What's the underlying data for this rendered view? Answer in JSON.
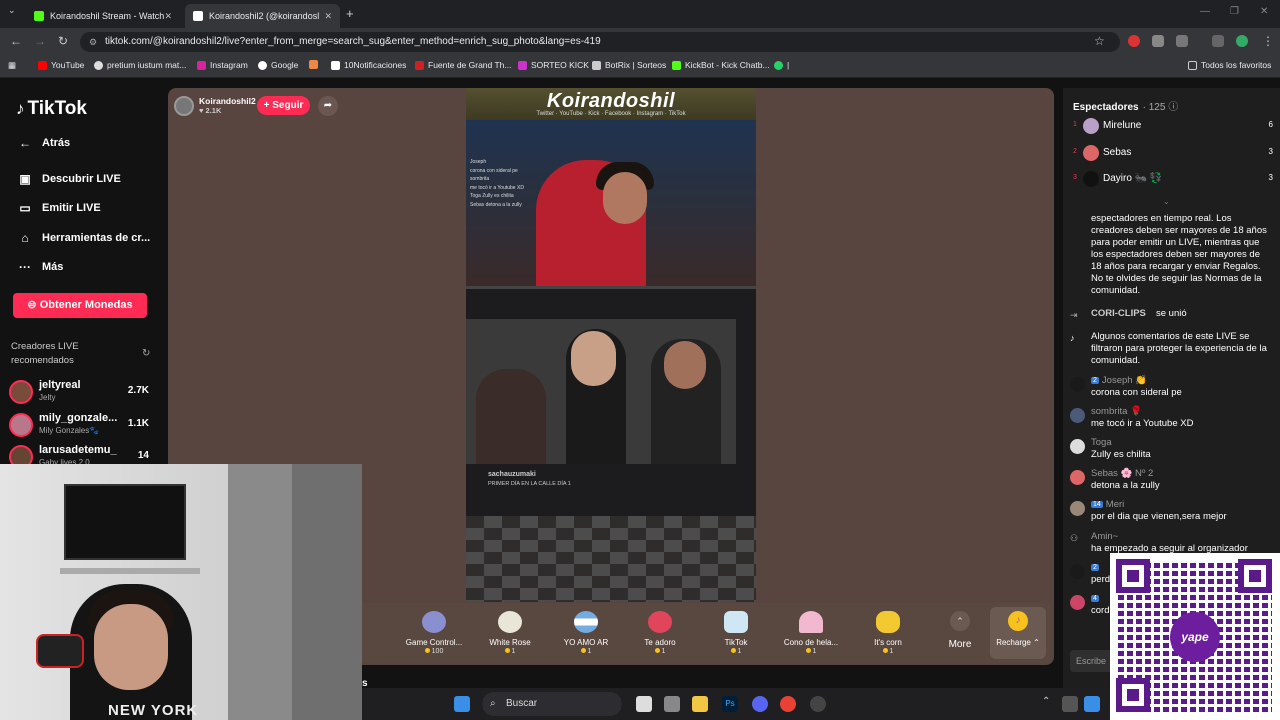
{
  "browser": {
    "tabs": [
      {
        "title": "Koirandoshil Stream - Watch Li"
      },
      {
        "title": "Koirandoshil2 (@koirandosl"
      }
    ],
    "url": "tiktok.com/@koirandoshil2/live?enter_from_merge=search_sug&enter_method=enrich_sug_photo&lang=es-419",
    "bookmarks": [
      "YouTube",
      "pretium iustum mat...",
      "Instagram",
      "Google",
      "10Notificaciones",
      "Fuente de Grand Th...",
      "SORTEO KICK",
      "BotRix | Sorteos",
      "KickBot - Kick Chatb...",
      "|"
    ],
    "all_favorites": "Todos los favoritos"
  },
  "sidebar": {
    "logo": "TikTok",
    "nav": [
      {
        "label": "Atrás"
      },
      {
        "label": "Descubrir LIVE"
      },
      {
        "label": "Emitir LIVE"
      },
      {
        "label": "Herramientas de cr..."
      },
      {
        "label": "Más"
      }
    ],
    "coins_button": "Obtener Monedas",
    "recommended_title": "Creadores LIVE recomendados",
    "creators": [
      {
        "name": "jeltyreal",
        "sub": "Jelty",
        "count": "2.7K"
      },
      {
        "name": "mily_gonzale...",
        "sub": "Mily Gonzales🐾",
        "count": "1.1K"
      },
      {
        "name": "larusadetemu_",
        "sub": "Gaby lives 2.0",
        "count": "14"
      }
    ]
  },
  "host": {
    "name": "Koirandoshil2",
    "likes": "♥ 2.1K",
    "follow": "+ Seguir"
  },
  "video": {
    "banner": "Koirandoshil",
    "banner_sub": "Twitter · YouTube · Kick · Facebook · Instagram · TikTok",
    "chat_lines": [
      "Joseph",
      "corona con sideral pe",
      "sombrita",
      "me tocó ir a Youtube XD",
      "Toga  Zully es chilita",
      "Sebas  detona a la zully"
    ],
    "overlay_name": "sachauzumaki",
    "overlay_sub": "PRIMER DÍA EN LA CALLE DÍA 1"
  },
  "gifts": [
    {
      "name": "Game Control...",
      "price": "100"
    },
    {
      "name": "White Rose",
      "price": "1"
    },
    {
      "name": "YO AMO AR",
      "price": "1"
    },
    {
      "name": "Te adoro",
      "price": "1"
    },
    {
      "name": "TikTok",
      "price": "1"
    },
    {
      "name": "Cono de hela...",
      "price": "1"
    },
    {
      "name": "It's corn",
      "price": "1"
    }
  ],
  "gift_more": "More",
  "recharge": "Recharge ⌃",
  "viewers": {
    "title": "Espectadores",
    "count": "· 125",
    "list": [
      {
        "rank": "1",
        "name": "Mirelune",
        "score": "6"
      },
      {
        "rank": "2",
        "name": "Sebas",
        "score": "3"
      },
      {
        "rank": "3",
        "name": "Dayiro 🐜 💱",
        "score": "3"
      }
    ]
  },
  "chat": {
    "system_1": "espectadores en tiempo real. Los creadores deben ser mayores de 18 años para poder emitir un LIVE, mientras que los espectadores deben ser mayores de 18 años para recargar y enviar Regalos. No te olvides de seguir las Normas de la comunidad.",
    "join_user": "CORI-CLIPS",
    "join_text": "se unió",
    "system_2": "Algunos comentarios de este LIVE se filtraron para proteger la experiencia de la comunidad.",
    "messages": [
      {
        "badge": "2",
        "user": "Joseph 👏",
        "msg": "corona con sideral pe"
      },
      {
        "badge": "",
        "user": "sombrita 🌹",
        "msg": "me tocó ir a Youtube XD"
      },
      {
        "badge": "",
        "user": "Toga",
        "msg": "Zully es chilita"
      },
      {
        "badge": "",
        "user": "Sebas 🌸 Nº 2",
        "msg": "detona a la zully"
      },
      {
        "badge": "14",
        "user": "Meri",
        "msg": "por el dia que vienen,sera mejor"
      },
      {
        "badge": "",
        "user": "Amin~",
        "msg": "ha empezado a seguir al organizador"
      },
      {
        "badge": "2",
        "user": "",
        "msg": "perd"
      },
      {
        "badge": "4",
        "user": "",
        "msg": "cord"
      }
    ],
    "input_placeholder": "Escribe"
  },
  "taskbar": {
    "search": "Buscar"
  },
  "webcam": {
    "shirt_text": "NEW YORK"
  },
  "qr": {
    "brand": "yape"
  },
  "colors": {
    "accent": "#fe2c55",
    "stage_bg": "#58453f",
    "yape_purple": "#6c1e9e"
  }
}
